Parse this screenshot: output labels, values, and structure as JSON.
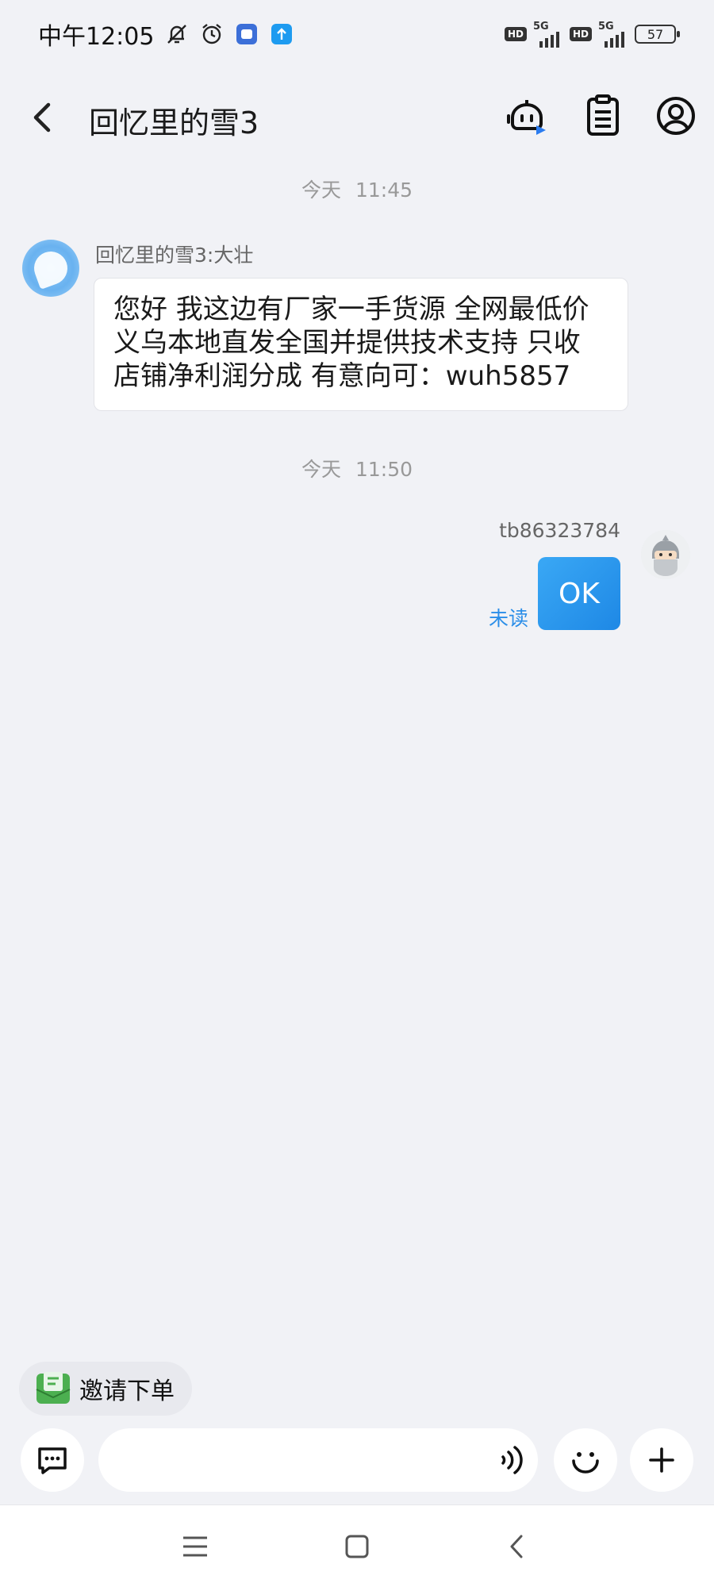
{
  "status_bar": {
    "time": "中午12:05",
    "hd1": "HD",
    "net1": "5G",
    "hd2": "HD",
    "net2": "5G",
    "battery": "57"
  },
  "header": {
    "title": "回忆里的雪3"
  },
  "messages": [
    {
      "timestamp_day": "今天",
      "timestamp_time": "11:45",
      "sender": "回忆里的雪3:大壮",
      "lines": [
        "您好 我这边有厂家一手货源 全网最低价",
        "义乌本地直发全国并提供技术支持 只收",
        "店铺净利润分成 有意向可：wuh5857"
      ]
    },
    {
      "timestamp_day": "今天",
      "timestamp_time": "11:50",
      "sender": "tb86323784",
      "text": "OK",
      "status": "未读"
    }
  ],
  "quick_action": {
    "label": "邀请下单"
  },
  "input": {
    "placeholder": ""
  },
  "colors": {
    "background": "#f1f2f6",
    "accent": "#1e88e5",
    "unread": "#2b8ee8"
  }
}
